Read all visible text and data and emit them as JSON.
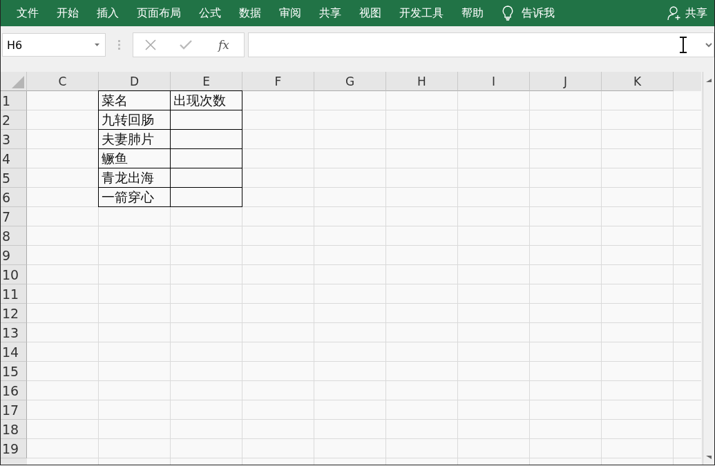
{
  "menu_tabs": [
    {
      "label": "文件"
    },
    {
      "label": "开始"
    },
    {
      "label": "插入"
    },
    {
      "label": "页面布局"
    },
    {
      "label": "公式"
    },
    {
      "label": "数据"
    },
    {
      "label": "审阅"
    },
    {
      "label": "共享"
    },
    {
      "label": "视图"
    },
    {
      "label": "开发工具"
    },
    {
      "label": "帮助"
    }
  ],
  "tell_me": {
    "label": "告诉我"
  },
  "share": {
    "label": "共享"
  },
  "name_box": {
    "value": "H6"
  },
  "formula_bar": {
    "function_label": "fx"
  },
  "sheet": {
    "columns": [
      "C",
      "D",
      "E",
      "F",
      "G",
      "H",
      "I",
      "J",
      "K"
    ],
    "rows": [
      {
        "number": "1",
        "cells": [
          {
            "bordered": false
          },
          {
            "text": "菜名",
            "bordered": true
          },
          {
            "text": "出现次数",
            "bordered": true
          }
        ]
      },
      {
        "number": "2",
        "cells": [
          {
            "bordered": false
          },
          {
            "text": "九转回肠",
            "bordered": true
          },
          {
            "bordered": true
          }
        ]
      },
      {
        "number": "3",
        "cells": [
          {
            "bordered": false
          },
          {
            "text": "夫妻肺片",
            "bordered": true
          },
          {
            "bordered": true
          }
        ]
      },
      {
        "number": "4",
        "cells": [
          {
            "bordered": false
          },
          {
            "text": "鳜鱼",
            "bordered": true
          },
          {
            "bordered": true
          }
        ]
      },
      {
        "number": "5",
        "cells": [
          {
            "bordered": false
          },
          {
            "text": "青龙出海",
            "bordered": true
          },
          {
            "bordered": true
          }
        ]
      },
      {
        "number": "6",
        "cells": [
          {
            "bordered": false
          },
          {
            "text": "一箭穿心",
            "bordered": true
          },
          {
            "bordered": true
          }
        ]
      },
      {
        "number": "7",
        "cells": []
      },
      {
        "number": "8",
        "cells": []
      },
      {
        "number": "9",
        "cells": []
      },
      {
        "number": "10",
        "cells": []
      },
      {
        "number": "11",
        "cells": []
      },
      {
        "number": "12",
        "cells": []
      },
      {
        "number": "13",
        "cells": []
      },
      {
        "number": "14",
        "cells": []
      },
      {
        "number": "15",
        "cells": []
      },
      {
        "number": "16",
        "cells": []
      },
      {
        "number": "17",
        "cells": []
      },
      {
        "number": "18",
        "cells": []
      },
      {
        "number": "19",
        "cells": []
      }
    ]
  }
}
